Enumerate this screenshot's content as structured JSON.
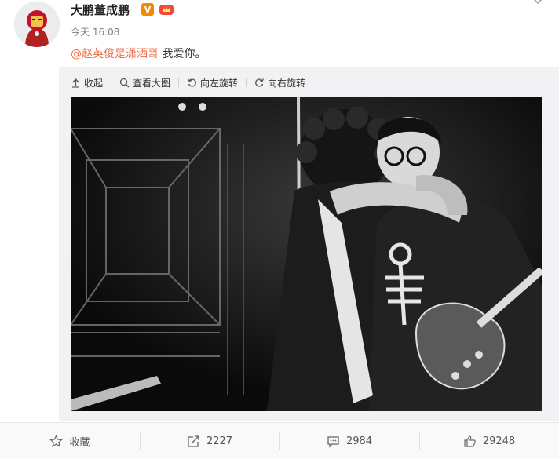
{
  "user": {
    "name": "大鹏董成鹏",
    "verified_badge": "V"
  },
  "post": {
    "time": "今天 16:08",
    "mention": "@赵英俊是潇洒哥",
    "text": " 我爱你。"
  },
  "media_toolbar": {
    "collapse": "收起",
    "view_large": "查看大图",
    "rotate_left": "向左旋转",
    "rotate_right": "向右旋转"
  },
  "actions": {
    "favorite": "收藏",
    "repost_count": "2227",
    "comment_count": "2984",
    "like_count": "29248"
  },
  "colors": {
    "mention": "#eb7350",
    "badge": "#f08a00",
    "panel_bg": "#f2f2f5"
  }
}
